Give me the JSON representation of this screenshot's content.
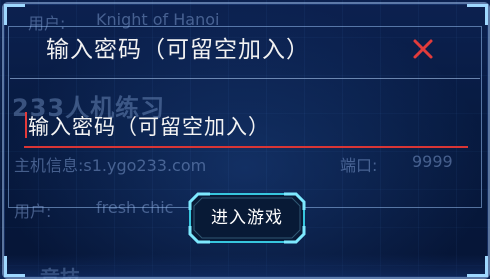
{
  "dialog": {
    "title": "输入密码（可留空加入）",
    "password_placeholder": "输入密码（可留空加入）",
    "password_value": "",
    "enter_button_label": "进入游戏"
  },
  "background": {
    "user_label_top": "用户:",
    "user_value_top": "Knight of Hanoi",
    "section_title": "233人机练习",
    "host_info": "主机信息:s1.ygo233.com",
    "port_label": "端口:",
    "port_value": "9999",
    "user_label_bottom": "用户:",
    "user_value_bottom": "fresh chic",
    "bottom_title": "竞技"
  },
  "colors": {
    "accent_red": "#d93535",
    "close_icon": "#e23b3b",
    "button_glow": "#3fd2e8",
    "text_white": "#f2f2f2"
  },
  "icons": {
    "close": "close-icon"
  }
}
